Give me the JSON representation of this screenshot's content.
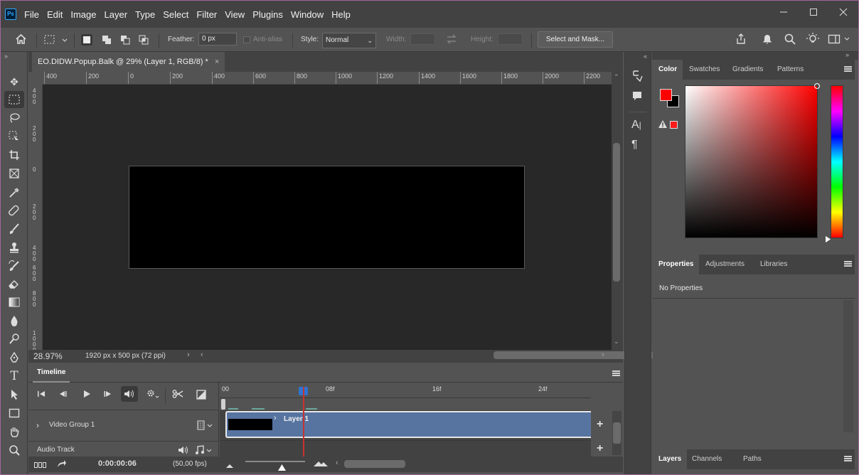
{
  "app": {
    "logo": "Ps",
    "menu": [
      "File",
      "Edit",
      "Image",
      "Layer",
      "Type",
      "Select",
      "Filter",
      "View",
      "Plugins",
      "Window",
      "Help"
    ],
    "window_controls": {
      "minimize": "minimize-icon",
      "maximize": "maximize-icon",
      "close": "close-icon"
    }
  },
  "options_bar": {
    "feather_label": "Feather:",
    "feather_value": "0 px",
    "antialias_label": "Anti-alias",
    "style_label": "Style:",
    "style_value": "Normal",
    "width_label": "Width:",
    "height_label": "Height:",
    "select_mask_label": "Select and Mask..."
  },
  "document": {
    "tab_title": "EO.DIDW.Popup.Balk @ 29% (Layer 1, RGB/8) *",
    "ruler_h": [
      "400",
      "200",
      "0",
      "200",
      "400",
      "600",
      "800",
      "1000",
      "1200",
      "1400",
      "1600",
      "1800",
      "2000",
      "2200"
    ],
    "ruler_v": [
      "4\n0\n0",
      "2\n0\n0",
      "0",
      "2\n0\n0",
      "4\n0\n0",
      "6\n0\n0",
      "8\n0\n0",
      "1\n0\n0\n0"
    ],
    "zoom": "28.97%",
    "doc_info": "1920 px x 500 px (72 ppi)"
  },
  "timeline": {
    "tab_label": "Timeline",
    "marks": [
      "00",
      "08f",
      "16f",
      "24f"
    ],
    "video_group_label": "Video Group 1",
    "audio_track_label": "Audio Track",
    "layer_clip_label": "Layer 1",
    "current_time": "0:00:00:06",
    "fps": "(50,00 fps)",
    "playhead_fraction": 0.2
  },
  "panels": {
    "color_tabs": [
      "Color",
      "Swatches",
      "Gradients",
      "Patterns"
    ],
    "properties_tabs": [
      "Properties",
      "Adjustments",
      "Libraries"
    ],
    "properties_text": "No Properties",
    "layers_tabs": [
      "Layers",
      "Channels",
      "Paths"
    ],
    "foreground_color": "#ff0000",
    "background_color": "#000000"
  }
}
